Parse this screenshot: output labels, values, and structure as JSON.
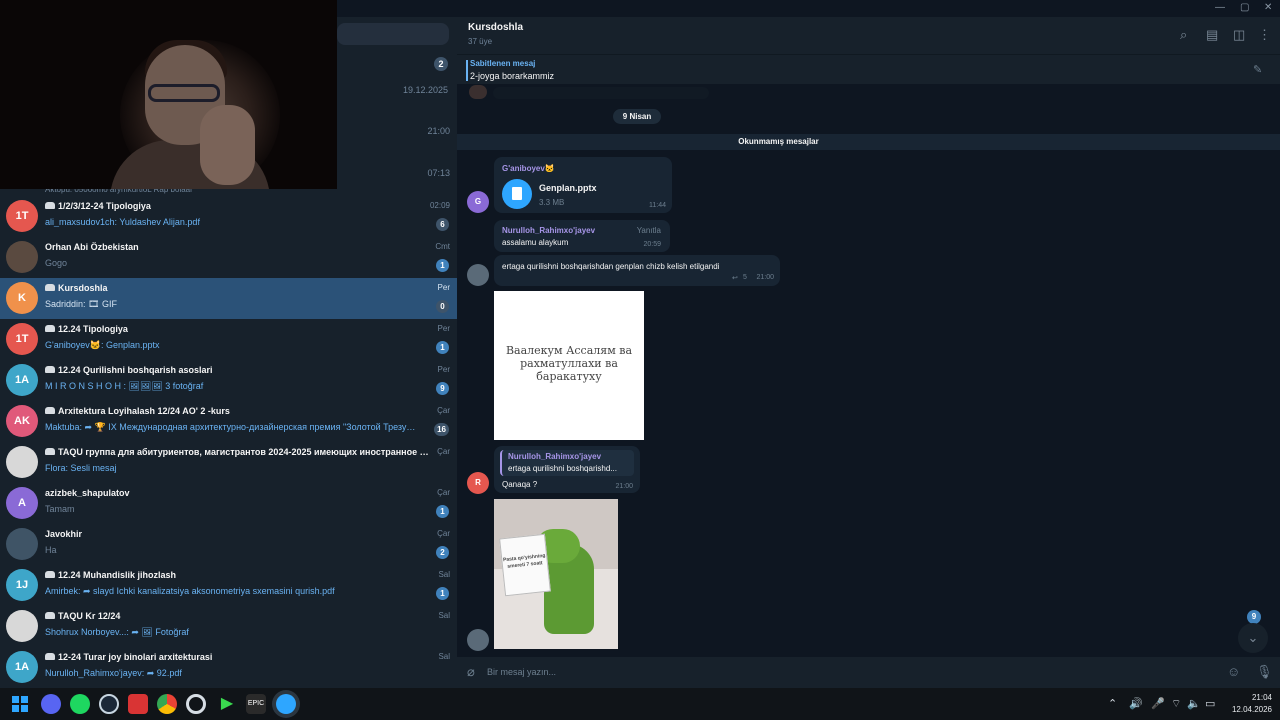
{
  "sidebar": {
    "stub_rows": [
      {
        "time": "",
        "badge": "2"
      },
      {
        "time": "19.12.2025",
        "badge": ""
      },
      {
        "time": "21:00",
        "badge": ""
      },
      {
        "time": "07:13",
        "badge": ""
      }
    ],
    "cut_preview": "Aktopu: 050oomo arymkurtloL Rap bolaal",
    "chats": [
      {
        "initials": "1T",
        "color": "#e5574f",
        "group": true,
        "name": "1/2/3/12-24 Tipologiya",
        "preview": "ali_maxsudov1ch: Yuldashev Alijan.pdf",
        "time": "02:09",
        "badge": "6",
        "muted": true
      },
      {
        "initials": "",
        "color": "#5a4a40",
        "group": false,
        "name": "Orhan Abi Özbekistan",
        "preview": "Gogo",
        "time": "Cmt",
        "badge": "1",
        "muted": false,
        "gray": true
      },
      {
        "initials": "K",
        "color": "#f0914b",
        "group": true,
        "name": "Kursdoshla",
        "preview": "Sadriddin: 🎞 GIF",
        "time": "Per",
        "badge": "0",
        "muted": true,
        "active": true
      },
      {
        "initials": "1T",
        "color": "#e5574f",
        "group": true,
        "name": "12.24 Tipologiya",
        "preview": "G'aniboyev🐱: Genplan.pptx",
        "time": "Per",
        "badge": "1",
        "muted": false
      },
      {
        "initials": "1A",
        "color": "#3ea6c9",
        "group": true,
        "name": "12.24 Qurilishni boshqarish asoslari",
        "preview": "M I R O N S H O H : 🖼🖼🖼 3 fotoğraf",
        "time": "Per",
        "badge": "9",
        "muted": false
      },
      {
        "initials": "AK",
        "color": "#e0597a",
        "group": true,
        "name": "Arxitektura Loyihalash 12/24 AO' 2 -kurs",
        "preview": "Maktuba: ➦ 🏆 IX Международная архитектурно-дизайнерская премия \"Золотой Трезу…",
        "time": "Çar",
        "badge": "16",
        "muted": true
      },
      {
        "initials": "",
        "color": "#d8d8d8",
        "group": true,
        "name": "TAQU группа для абитуриентов, магистрантов 2024-2025 имеющих иностранное гра…",
        "preview": "Flora: Sesli mesaj",
        "time": "Çar",
        "badge": "",
        "muted": false
      },
      {
        "initials": "A",
        "color": "#8a6ad6",
        "group": false,
        "name": "azizbek_shapulatov",
        "preview": "Tamam",
        "time": "Çar",
        "badge": "1",
        "muted": false,
        "gray": true
      },
      {
        "initials": "",
        "color": "#3f5466",
        "group": false,
        "name": "Javokhir",
        "preview": "Ha",
        "time": "Çar",
        "badge": "2",
        "muted": false,
        "gray": true
      },
      {
        "initials": "1J",
        "color": "#3ea6c9",
        "group": true,
        "name": "12.24 Muhandislik jihozlash",
        "preview": "Amirbek: ➦ slayd Ichki kanalizatsiya aksonometriya sxemasini qurish.pdf",
        "time": "Sal",
        "badge": "1",
        "muted": false
      },
      {
        "initials": "",
        "color": "#d8d8d8",
        "group": true,
        "name": "TAQU Kr 12/24",
        "preview": "Shohrux Norboyev...: ➦ 🖼 Fotoğraf",
        "time": "Sal",
        "badge": "",
        "muted": false
      },
      {
        "initials": "1A",
        "color": "#3ea6c9",
        "group": true,
        "name": "12-24 Turar joy binolari arxitekturasi",
        "preview": "Nurulloh_Rahimxo'jayev: ➦ 92.pdf",
        "time": "Sal",
        "badge": "",
        "muted": false
      }
    ]
  },
  "header": {
    "title": "Kursdoshla",
    "subtitle": "37 üye"
  },
  "pinned": {
    "title": "Sabitlenen mesaj",
    "text": "2-joyga borarkammiz"
  },
  "main": {
    "date_pill": "9 Nisan",
    "unread_label": "Okunmamış mesajlar",
    "messages": {
      "m1": {
        "avatar": "G",
        "avatar_color": "#8a6ad6",
        "sender": "G'aniboyev🐱",
        "sender_color": "#a695e7",
        "file_name": "Genplan.pptx",
        "file_size": "3.3 MB",
        "time": "11:44"
      },
      "m2": {
        "sender": "Nurulloh_Rahimxo'jayev",
        "sender_color": "#a695e7",
        "reply_label": "Yanıtla",
        "text": "assalamu alaykum",
        "time": "20:59"
      },
      "m3": {
        "text": "ertaga qurilishni boshqarishdan genplan chizb kelish etilgandi",
        "replies": "5",
        "time": "21:00"
      },
      "m4": {
        "image_text": "Ваалекум Ассалям ва рахматуллахи ва баракатуху"
      },
      "m5": {
        "avatar": "R",
        "avatar_color": "#e5574f",
        "quote_sender": "Nurulloh_Rahimxo'jayev",
        "quote_text": "ertaga qurilishni boshqarishd...",
        "text": "Qanaqa ?",
        "time": "21:00"
      },
      "m6": {
        "image_text": "Pasta qo'yishning smereti 7 soatt"
      }
    },
    "scroll_badge": "9"
  },
  "composer": {
    "placeholder": "Bir mesaj yazın..."
  },
  "taskbar": {
    "time": "21:04",
    "date": "12.04.2026",
    "apps": [
      "discord",
      "spotify",
      "steam",
      "app-red",
      "chrome",
      "opera-gx",
      "game",
      "epic",
      "telegram"
    ]
  }
}
